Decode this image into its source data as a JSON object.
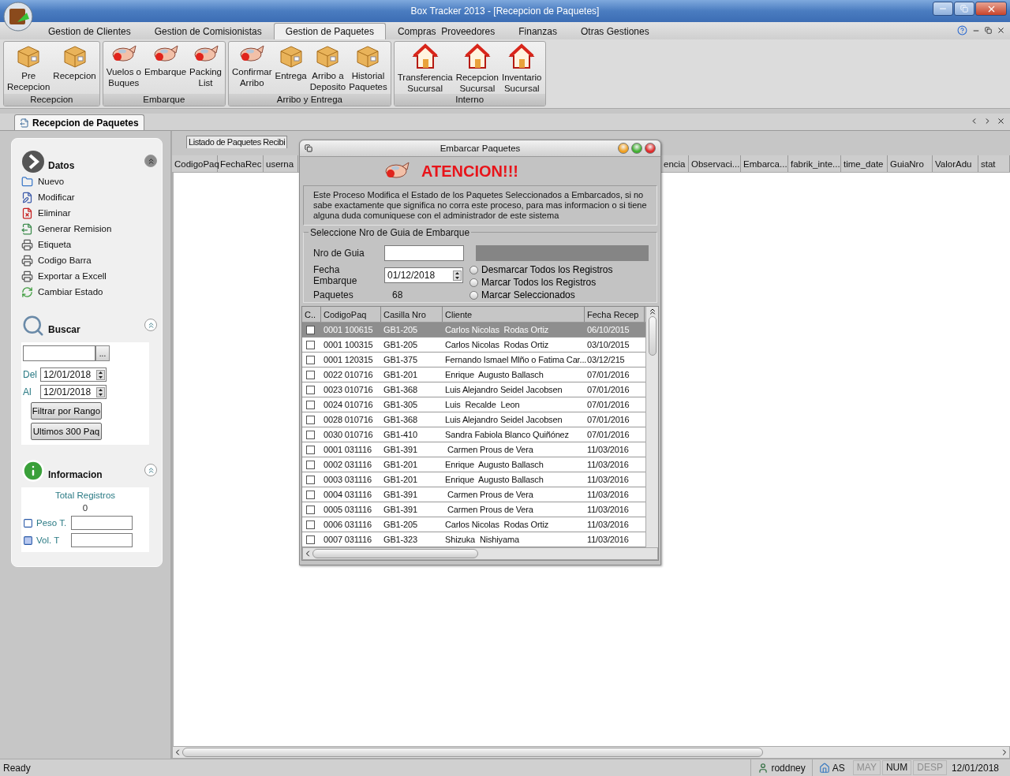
{
  "window": {
    "title": "Box Tracker 2013 - [Recepcion de Paquetes]"
  },
  "ribbon": {
    "tabs": [
      {
        "label": "Gestion de Clientes",
        "selected": false
      },
      {
        "label": "Gestion de Comisionistas",
        "selected": false
      },
      {
        "label": "Gestion de Paquetes",
        "selected": true
      },
      {
        "label": "Compras  Proveedores",
        "selected": false
      },
      {
        "label": "Finanzas",
        "selected": false
      },
      {
        "label": "Otras Gestiones",
        "selected": false
      }
    ],
    "groups": [
      {
        "label": "Recepcion",
        "items": [
          "Pre\nRecepcion",
          "Recepcion"
        ]
      },
      {
        "label": "Embarque",
        "items": [
          "Vuelos o\nBuques",
          "Embarque",
          "Packing\nList"
        ]
      },
      {
        "label": "Arribo y Entrega",
        "items": [
          "Confirmar\nArribo",
          "Entrega",
          "Arribo a\nDeposito",
          "Historial\nPaquetes"
        ]
      },
      {
        "label": "Interno",
        "items": [
          "Transferencia\nSucursal",
          "Recepcion\nSucursal",
          "Inventario\nSucursal"
        ]
      }
    ]
  },
  "document_tab": {
    "label": "Recepcion de Paquetes"
  },
  "sidebar": {
    "datos": {
      "title": "Datos",
      "items": [
        "Nuevo",
        "Modificar",
        "Eliminar",
        "Generar Remision",
        "Etiqueta",
        "Codigo Barra",
        "Exportar a Excell",
        "Cambiar Estado"
      ]
    },
    "buscar": {
      "title": "Buscar",
      "browse": "...",
      "del_label": "Del",
      "del_value": "12/01/2018",
      "al_label": "Al",
      "al_value": "12/01/2018",
      "buttons": [
        "Filtrar por Rango",
        "Ultimos 300 Paq"
      ]
    },
    "informacion": {
      "title": "Informacion",
      "total_label": "Total Registros",
      "total_value": "0",
      "peso_label": "Peso T.",
      "vol_label": "Vol. T"
    }
  },
  "listing": {
    "tab": "Listado de Paquetes Recibi",
    "columns_left": [
      "CodigoPaq",
      "FechaRec",
      "userna"
    ],
    "columns_right": [
      "encia",
      "Observaci...",
      "Embarca...",
      "fabrik_inte...",
      "time_date",
      "GuiaNro",
      "ValorAdu",
      "stat"
    ]
  },
  "dialog": {
    "title": "Embarcar Paquetes",
    "heading": "ATENCION!!!",
    "message": "Este Proceso Modifica el Estado de los Paquetes Seleccionados a Embarcados, si no sabe exactamente que significa no corra este proceso, para mas informacion o si tiene alguna duda comuniquese con el administrador de este sistema",
    "group_title": "Seleccione Nro de Guia de Embarque",
    "guia_label": "Nro de Guia",
    "fecha_label": "Fecha Embarque",
    "fecha_value": "01/12/2018",
    "paquetes_label": "Paquetes",
    "paquetes_value": "68",
    "options": [
      {
        "label": "Desmarcar Todos los Registros",
        "selected": false
      },
      {
        "label": "Marcar Todos los Registros",
        "selected": false
      },
      {
        "label": "Marcar Seleccionados",
        "selected": false
      }
    ],
    "check_header": "C..",
    "columns": [
      "CodigoPaq",
      "Casilla Nro",
      "Cliente",
      "Fecha Recep"
    ],
    "rows": [
      {
        "checked": false,
        "selected": true,
        "cells": [
          "0001 100615",
          "GB1-205",
          "Carlos Nicolas  Rodas Ortiz",
          "06/10/2015"
        ]
      },
      {
        "checked": false,
        "selected": false,
        "cells": [
          "0001 100315",
          "GB1-205",
          "Carlos Nicolas  Rodas Ortiz",
          "03/10/2015"
        ]
      },
      {
        "checked": false,
        "selected": false,
        "cells": [
          "0001 120315",
          "GB1-375",
          "Fernando Ismael Mlño o Fatima Car...",
          "03/12/215"
        ]
      },
      {
        "checked": false,
        "selected": false,
        "cells": [
          "0022 010716",
          "GB1-201",
          "Enrique  Augusto Ballasch",
          "07/01/2016"
        ]
      },
      {
        "checked": false,
        "selected": false,
        "cells": [
          "0023 010716",
          "GB1-368",
          "Luis Alejandro Seidel Jacobsen",
          "07/01/2016"
        ]
      },
      {
        "checked": false,
        "selected": false,
        "cells": [
          "0024 010716",
          "GB1-305",
          "Luis  Recalde  Leon",
          "07/01/2016"
        ]
      },
      {
        "checked": false,
        "selected": false,
        "cells": [
          "0028 010716",
          "GB1-368",
          "Luis Alejandro Seidel Jacobsen",
          "07/01/2016"
        ]
      },
      {
        "checked": false,
        "selected": false,
        "cells": [
          "0030 010716",
          "GB1-410",
          "Sandra Fabiola Blanco Quiñónez",
          "07/01/2016"
        ]
      },
      {
        "checked": false,
        "selected": false,
        "cells": [
          "0001 031116",
          "GB1-391",
          " Carmen Prous de Vera",
          "11/03/2016"
        ]
      },
      {
        "checked": false,
        "selected": false,
        "cells": [
          "0002 031116",
          "GB1-201",
          "Enrique  Augusto Ballasch",
          "11/03/2016"
        ]
      },
      {
        "checked": false,
        "selected": false,
        "cells": [
          "0003 031116",
          "GB1-201",
          "Enrique  Augusto Ballasch",
          "11/03/2016"
        ]
      },
      {
        "checked": false,
        "selected": false,
        "cells": [
          "0004 031116",
          "GB1-391",
          " Carmen Prous de Vera",
          "11/03/2016"
        ]
      },
      {
        "checked": false,
        "selected": false,
        "cells": [
          "0005 031116",
          "GB1-391",
          " Carmen Prous de Vera",
          "11/03/2016"
        ]
      },
      {
        "checked": false,
        "selected": false,
        "cells": [
          "0006 031116",
          "GB1-205",
          "Carlos Nicolas  Rodas Ortiz",
          "11/03/2016"
        ]
      },
      {
        "checked": false,
        "selected": false,
        "cells": [
          "0007 031116",
          "GB1-323",
          "Shizuka  Nishiyama",
          "11/03/2016"
        ]
      }
    ]
  },
  "status_bar": {
    "message": "Ready",
    "user": "roddney",
    "site": "AS",
    "indicators": [
      {
        "label": "MAY",
        "on": false
      },
      {
        "label": "NUM",
        "on": true
      },
      {
        "label": "DESP",
        "on": false
      }
    ],
    "date": "12/01/2018"
  }
}
